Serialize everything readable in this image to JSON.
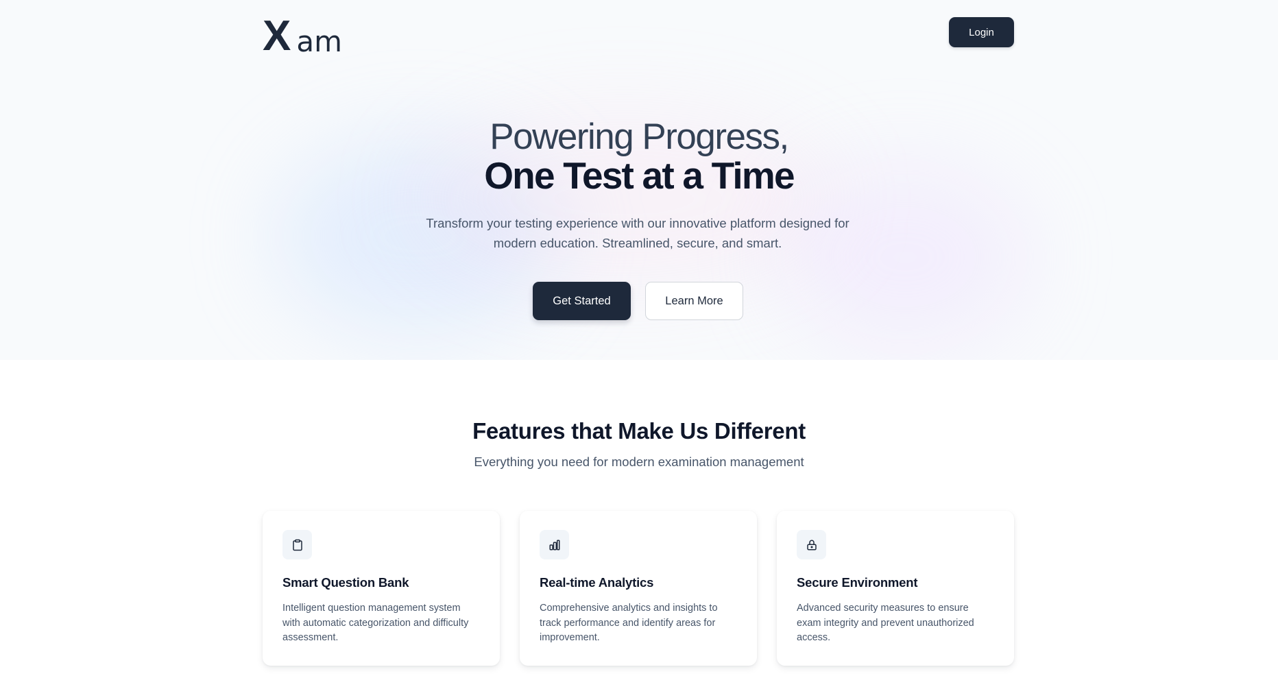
{
  "nav": {
    "logo_mark": "X",
    "logo_text": "am",
    "login_label": "Login"
  },
  "hero": {
    "title_line1": "Powering Progress,",
    "title_line2": "One Test at a Time",
    "subtitle": "Transform your testing experience with our innovative platform designed for modern education. Streamlined, secure, and smart.",
    "primary_cta": "Get Started",
    "secondary_cta": "Learn More"
  },
  "features": {
    "title": "Features that Make Us Different",
    "subtitle": "Everything you need for modern examination management",
    "cards": [
      {
        "icon": "clipboard-icon",
        "title": "Smart Question Bank",
        "description": "Intelligent question management system with automatic categorization and difficulty assessment."
      },
      {
        "icon": "bar-chart-icon",
        "title": "Real-time Analytics",
        "description": "Comprehensive analytics and insights to track performance and identify areas for improvement."
      },
      {
        "icon": "lock-icon",
        "title": "Secure Environment",
        "description": "Advanced security measures to ensure exam integrity and prevent unauthorized access."
      }
    ]
  },
  "colors": {
    "primary": "#1e293b",
    "heading": "#0f172a",
    "body_text": "#475569",
    "hero_background": "#f8fafc",
    "icon_background": "#f1f5f9"
  }
}
